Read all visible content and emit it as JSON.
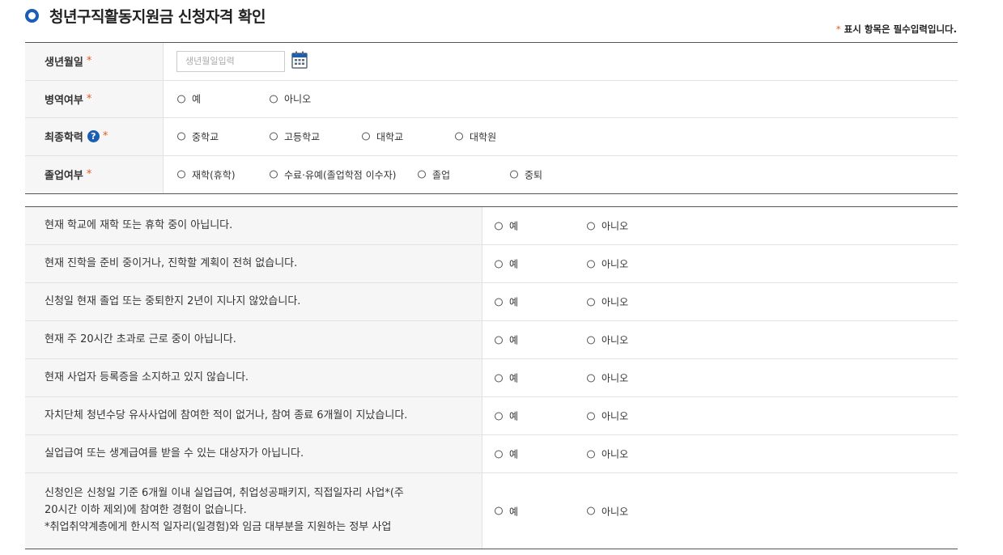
{
  "header": {
    "title": "청년구직활동지원금 신청자격 확인",
    "required_star": "*",
    "required_note": "표시 항목은 필수입력입니다."
  },
  "basic_info": {
    "birth": {
      "label": "생년월일",
      "placeholder": "생년월일입력"
    },
    "military": {
      "label": "병역여부",
      "options": [
        "예",
        "아니오"
      ]
    },
    "education": {
      "label": "최종학력",
      "help": "?",
      "options": [
        "중학교",
        "고등학교",
        "대학교",
        "대학원"
      ]
    },
    "graduation": {
      "label": "졸업여부",
      "options": [
        "재학(휴학)",
        "수료·유예(졸업학점 이수자)",
        "졸업",
        "중퇴"
      ]
    },
    "star": "*"
  },
  "eligibility": {
    "yes_label": "예",
    "no_label": "아니오",
    "questions": [
      "현재 학교에 재학 또는 휴학 중이 아닙니다.",
      "현재 진학을 준비 중이거나, 진학할 계획이 전혀 없습니다.",
      "신청일 현재 졸업 또는 중퇴한지 2년이 지나지 않았습니다.",
      "현재 주 20시간 초과로 근로 중이 아닙니다.",
      "현재 사업자 등록증을 소지하고 있지 않습니다.",
      "자치단체 청년수당 유사사업에 참여한 적이 없거나, 참여 종료 6개월이 지났습니다.",
      "실업급여 또는 생계급여를 받을 수 있는 대상자가 아닙니다."
    ],
    "last_question_line1": "신청인은 신청일 기준 6개월 이내 실업급여, 취업성공패키지, 직접일자리 사업*(주",
    "last_question_line2": "20시간 이하 제외)에 참여한 경험이 없습니다.",
    "last_question_line3": "*취업취약계층에게 한시적 일자리(일경험)와 임금 대부분을 지원하는 정부 사업"
  }
}
